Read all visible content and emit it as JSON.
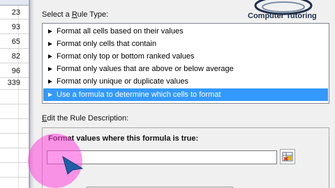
{
  "sheet": {
    "cells": [
      "23",
      "93",
      "65",
      "82",
      "96",
      "339"
    ]
  },
  "dialog": {
    "select_rule_type_label_prefix": "Select a ",
    "select_rule_type_label_key": "R",
    "select_rule_type_label_suffix": "ule Type:",
    "rule_types": [
      "Format all cells based on their values",
      "Format only cells that contain",
      "Format only top or bottom ranked values",
      "Format only values that are above or below average",
      "Format only unique or duplicate values",
      "Use a formula to determine which cells to format"
    ],
    "selected_index": 5,
    "edit_rule_label_prefix": "",
    "edit_rule_label_key": "E",
    "edit_rule_label_suffix": "dit the Rule Description:",
    "formula_label_key": "O",
    "formula_label_text": "Format values where this formula is true:",
    "formula_value": ""
  },
  "logo": {
    "text": "Computer Tutoring"
  },
  "colors": {
    "selection": "#3399ff",
    "cursor_highlight": "#ff46dc",
    "cursor_arrow": "#1f5fa8"
  }
}
